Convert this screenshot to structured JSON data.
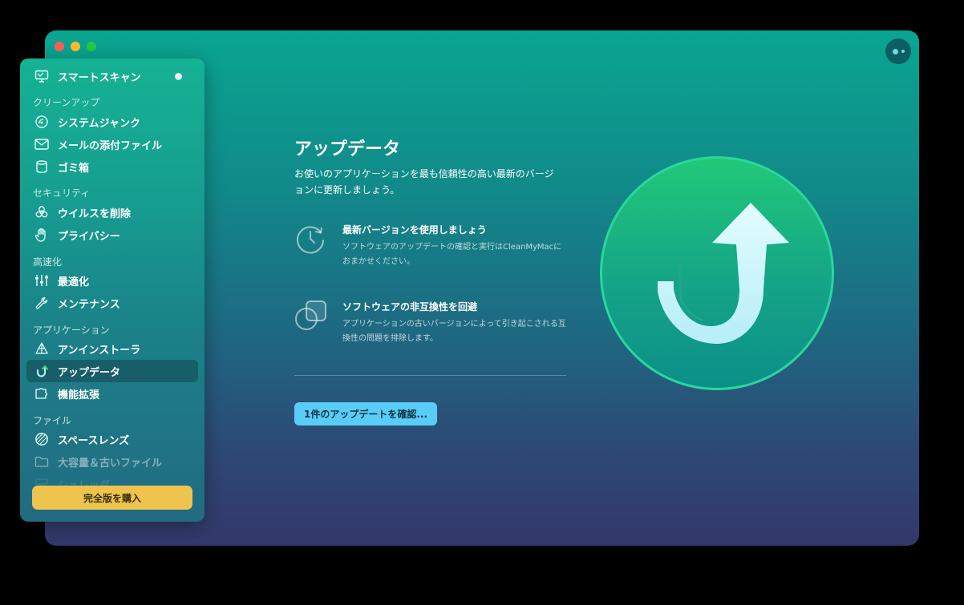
{
  "sidebar": {
    "smart_scan": "スマートスキャン",
    "sections": {
      "cleanup": "クリーンアップ",
      "security": "セキュリティ",
      "speed": "高速化",
      "applications": "アプリケーション",
      "files": "ファイル"
    },
    "items": {
      "system_junk": "システムジャンク",
      "mail_attachments": "メールの添付ファイル",
      "trash": "ゴミ箱",
      "malware": "ウイルスを削除",
      "privacy": "プライバシー",
      "optimization": "最適化",
      "maintenance": "メンテナンス",
      "uninstaller": "アンインストーラ",
      "updater": "アップデータ",
      "extensions": "機能拡張",
      "space_lens": "スペースレンズ",
      "large_old_files": "大容量＆古いファイル",
      "shredder": "シュレッダ"
    },
    "buy_label": "完全版を購入"
  },
  "main": {
    "title": "アップデータ",
    "description": "お使いのアプリケーションを最も信頼性の高い最新のバージョンに更新しましょう。",
    "features": [
      {
        "title": "最新バージョンを使用しましょう",
        "desc": "ソフトウェアのアップデートの確認と実行はCleanMyMacにおまかせください。",
        "icon": "clock-refresh-icon"
      },
      {
        "title": "ソフトウェアの非互換性を回避",
        "desc": "アプリケーションの古いバージョンによって引き起こされる互換性の問題を排除します。",
        "icon": "overlap-shapes-icon"
      }
    ],
    "cta_label": "1件のアップデートを確認..."
  },
  "colors": {
    "accent_button": "#59cdf7",
    "buy_button": "#eec44f",
    "hero_green": "#1dc47f",
    "traffic_red": "#fe5f57",
    "traffic_yellow": "#febc2e",
    "traffic_green": "#28c840"
  }
}
